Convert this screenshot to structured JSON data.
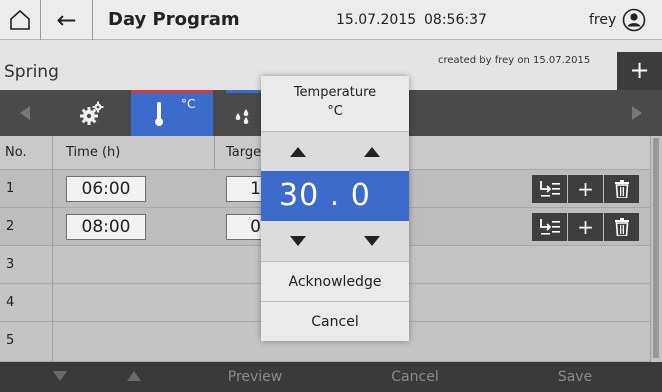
{
  "header": {
    "title": "Day Program",
    "date": "15.07.2015",
    "time": "08:56:37",
    "user": "frey"
  },
  "program": {
    "name": "Spring",
    "created": "created by frey on 15.07.2015"
  },
  "tabs": {
    "temp_unit": "°C"
  },
  "table": {
    "headers": {
      "no": "No.",
      "time": "Time (h)",
      "target": "Targe"
    },
    "rows": [
      {
        "no": "1",
        "time": "06:00",
        "target": "1"
      },
      {
        "no": "2",
        "time": "08:00",
        "target": "0"
      },
      {
        "no": "3"
      },
      {
        "no": "4"
      },
      {
        "no": "5"
      }
    ]
  },
  "popup": {
    "title": "Temperature",
    "unit": "°C",
    "value": "30 . 0",
    "acknowledge": "Acknowledge",
    "cancel": "Cancel"
  },
  "footer": {
    "preview": "Preview",
    "cancel": "Cancel",
    "save": "Save"
  },
  "colors": {
    "accent": "#3d6bcc",
    "temp_tab_marker": "#d23c3c"
  }
}
